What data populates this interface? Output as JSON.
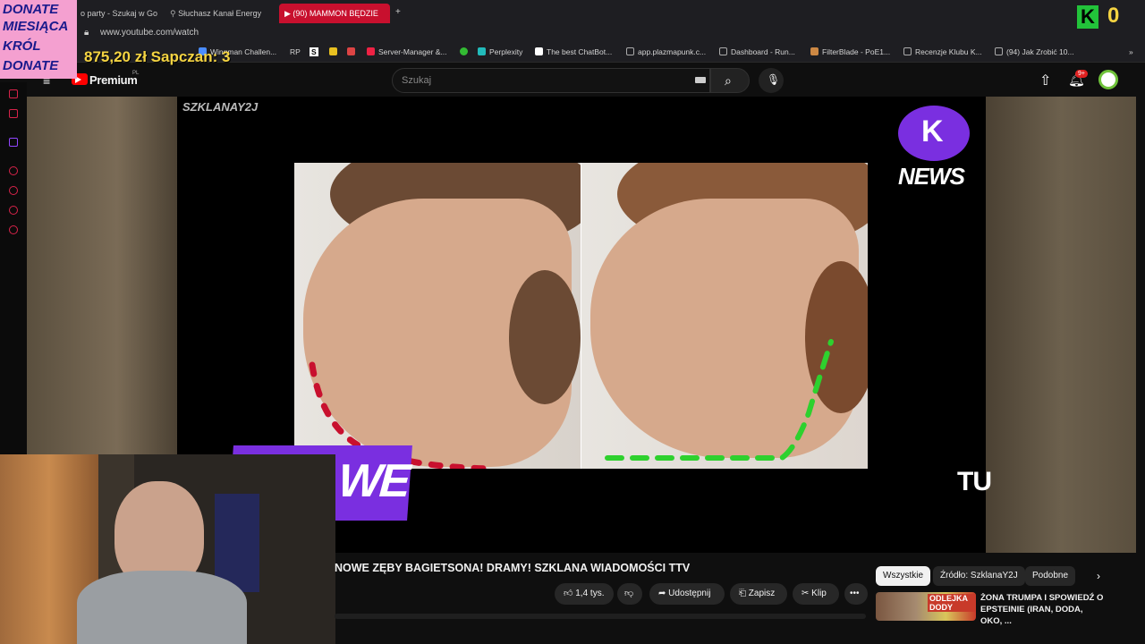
{
  "tabs": [
    {
      "label": "o party - Szukaj w Go"
    },
    {
      "label": "Słuchasz Kanał Energy"
    },
    {
      "label": "(90) MAMMON BĘDZIE"
    }
  ],
  "address": {
    "url": "www.youtube.com/watch"
  },
  "bookmarks": [
    {
      "label": "Wingman Challen...",
      "color": "#4a8cff"
    },
    {
      "label": "RP",
      "color": "#2a8"
    },
    {
      "label": "S",
      "color": "#fff"
    },
    {
      "label": "Server-Manager &...",
      "color": "#e24"
    },
    {
      "label": "Perplexity",
      "color": "#2bb"
    },
    {
      "label": "The best ChatBot...",
      "color": "#fff"
    },
    {
      "label": "app.plazmapunk.c...",
      "color": "#aaa"
    },
    {
      "label": "Dashboard - Run...",
      "color": "#aaa"
    },
    {
      "label": "FilterBlade - PoE1...",
      "color": "#c84"
    },
    {
      "label": "Recenzje Klubu K...",
      "color": "#aaa"
    },
    {
      "label": "(94) Jak Zrobić 10...",
      "color": "#aaa"
    }
  ],
  "youtube": {
    "brand": "Premium",
    "brand_region": "PL",
    "search_placeholder": "Szukaj",
    "notification_count": "9+"
  },
  "overlay": {
    "donate_lines": [
      "DONATE",
      "MIESIĄCA",
      "KRÓL",
      "DONATE"
    ],
    "goal_text": "875,20 zł Sapczan: 3",
    "counter_letter": "K",
    "counter_value": "0",
    "watermark": "SZKLANAY2J",
    "news_badge": "NEWS",
    "caption_fragment": "TU",
    "badge_fragment": "WE"
  },
  "video": {
    "title": "NOWE ZĘBY BAGIETSONA! DRAMY! SZKLANA WIADOMOŚCI TTV",
    "like_count": "1,4 tys.",
    "share_label": "Udostępnij",
    "save_label": "Zapisz",
    "clip_label": "Klip",
    "progress_fraction": 0.0
  },
  "chips": [
    {
      "label": "Wszystkie",
      "active": true
    },
    {
      "label": "Źródło: SzklanaY2J",
      "active": false
    },
    {
      "label": "Podobne",
      "active": false
    }
  ],
  "recommendation": {
    "title": "ŻONA TRUMPA I SPOWIEDŹ O EPSTEINIE (IRAN, DODA, OKO, ...",
    "thumb_text": "ODLEJKA DODY"
  },
  "colors": {
    "accent_red": "#c8102e",
    "donate_pink": "#f4a0d0",
    "goal_yellow": "#f5d442",
    "counter_green": "#22c33a",
    "badge_purple": "#7a2fe0",
    "dashes_red": "#c8102e",
    "dashes_green": "#2ed12e"
  }
}
